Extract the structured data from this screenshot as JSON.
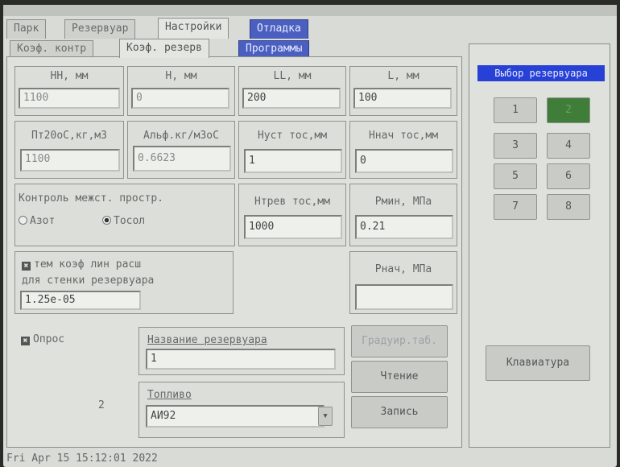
{
  "main_tabs": [
    "Парк",
    "Резервуар",
    "Настройки",
    "Отладка"
  ],
  "sub_tabs": [
    "Коэф. контр",
    "Коэф. резерв",
    "Программы"
  ],
  "fields": {
    "hh": {
      "label": "НН, мм",
      "value": "1100"
    },
    "h": {
      "label": "Н, мм",
      "value": "0"
    },
    "ll": {
      "label": "LL, мм",
      "value": "200"
    },
    "l": {
      "label": "L, мм",
      "value": "100"
    },
    "pt20": {
      "label": "Пт20оС,кг,м3",
      "value": "1100"
    },
    "alpha": {
      "label": "Альф.кг/м3оС",
      "value": "0.6623"
    },
    "nust": {
      "label": "Нуст тос,мм",
      "value": "1"
    },
    "nnach": {
      "label": "Ннач тос,мм",
      "value": "0"
    },
    "ntrev": {
      "label": "Нтрев тос,мм",
      "value": "1000"
    },
    "pmin": {
      "label": "Рмин, МПа",
      "value": "0.21"
    },
    "pnach": {
      "label": "Рнач, МПа",
      "value": ""
    }
  },
  "control": {
    "label": "Контроль межст. простр.",
    "option_nitrogen": "Азот",
    "option_tosol": "Тосол"
  },
  "tempcoef": {
    "check": "✖",
    "line1": "тем коэф лин расш",
    "line2": "для стенки резервуара",
    "value": "1.25e-05"
  },
  "poll": {
    "check": "✖",
    "label": "Опрос",
    "number": "2"
  },
  "tank_name": {
    "label": "Название резервуара",
    "value": "1"
  },
  "fuel": {
    "label": "Топливо",
    "value": "АИ92",
    "arrow": "▾"
  },
  "buttons": {
    "calib": "Градуир.таб.",
    "read": "Чтение",
    "write": "Запись"
  },
  "side": {
    "title": "Выбор резервуара",
    "tanks": [
      "1",
      "2",
      "3",
      "4",
      "5",
      "6",
      "7",
      "8"
    ],
    "keyboard": "Клавиатура"
  },
  "status": "Fri Apr 15 15:12:01 2022"
}
